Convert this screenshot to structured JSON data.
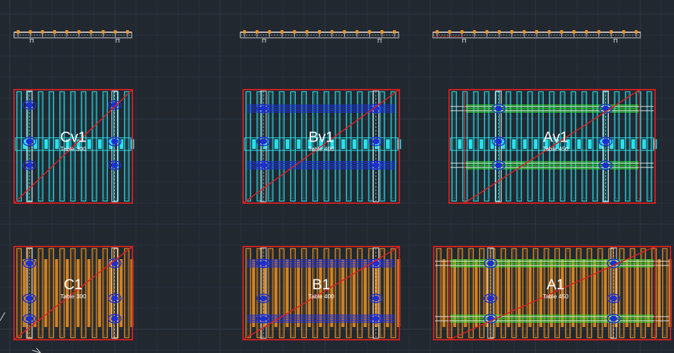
{
  "colors": {
    "background": "#212830",
    "grid_major": "#2f3a46",
    "grid_minor": "#27303a",
    "frame_red": "#e01f1f",
    "cyan": "#29e0ec",
    "orange": "#f0921e",
    "blue": "#1c2fd6",
    "green": "#2ee02e",
    "white": "#e6e6e6",
    "label": "#ffffff"
  },
  "panels": [
    {
      "id": "Cv1",
      "title": "Cv1",
      "subtitle": "Table 300",
      "style": "cyan",
      "beam": "red"
    },
    {
      "id": "Bv1",
      "title": "Bv1",
      "subtitle": "Table 400",
      "style": "cyan",
      "beam": "blue"
    },
    {
      "id": "Av1",
      "title": "Av1",
      "subtitle": "Table 450",
      "style": "cyan",
      "beam": "green"
    },
    {
      "id": "C1",
      "title": "C1",
      "subtitle": "Table 300",
      "style": "orange",
      "beam": "red"
    },
    {
      "id": "B1",
      "title": "B1",
      "subtitle": "Table 400",
      "style": "orange",
      "beam": "blue"
    },
    {
      "id": "A1",
      "title": "A1",
      "subtitle": "Table 450",
      "style": "orange",
      "beam": "green"
    }
  ],
  "elevations": [
    {
      "id": "elevation-c"
    },
    {
      "id": "elevation-b"
    },
    {
      "id": "elevation-a"
    }
  ],
  "icons": {
    "ucs_icon": "ucs-axis-icon"
  }
}
